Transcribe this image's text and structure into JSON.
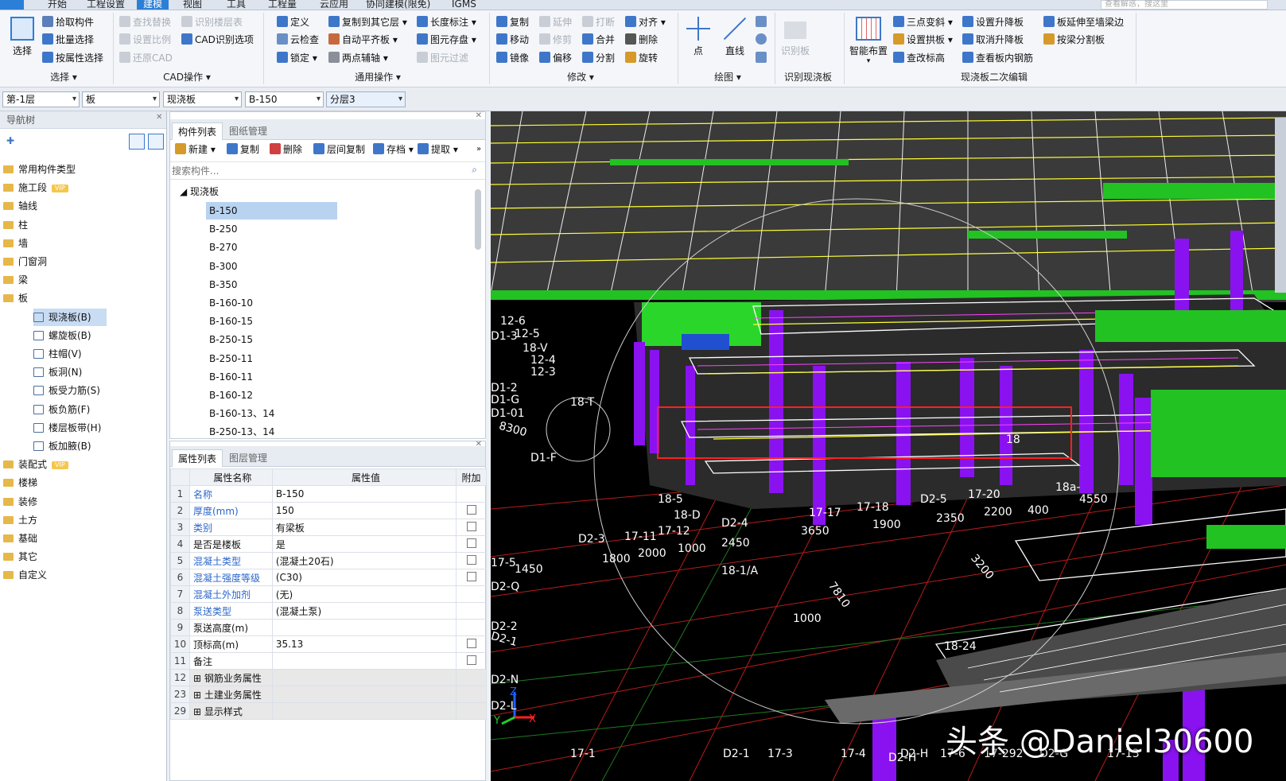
{
  "menubar": {
    "tabs": [
      "开始",
      "工程设置",
      "建模",
      "视图",
      "工具",
      "工程量",
      "云应用",
      "协同建模(限免)",
      "IGMS"
    ],
    "active_tab": "建模",
    "search_placeholder": "查看解惑，搜这里"
  },
  "ribbon": {
    "select_group": {
      "big": "选择",
      "items": [
        "拾取构件",
        "批量选择",
        "按属性选择"
      ],
      "label": "选择"
    },
    "cad_group": {
      "items": [
        "查找替换",
        "识别楼层表",
        "设置比例",
        "CAD识别选项",
        "还原CAD"
      ],
      "label": "CAD操作"
    },
    "general_group": {
      "items": [
        "定义",
        "复制到其它层",
        "长度标注",
        "云检查",
        "自动平齐板",
        "图元存盘",
        "锁定",
        "两点辅轴",
        "图元过滤"
      ],
      "label": "通用操作"
    },
    "modify_group": {
      "items": [
        "复制",
        "延伸",
        "打断",
        "对齐",
        "移动",
        "修剪",
        "合并",
        "删除",
        "镜像",
        "偏移",
        "分割",
        "旋转"
      ],
      "label": "修改"
    },
    "draw_group": {
      "items": [
        "点",
        "直线"
      ],
      "label": "绘图"
    },
    "identify_group": {
      "items": [
        "识别板"
      ],
      "label": "识别现浇板"
    },
    "edit_group": {
      "big": "智能布置",
      "items": [
        "三点变斜",
        "设置升降板",
        "板延伸至墙梁边",
        "设置拱板",
        "取消升降板",
        "按梁分割板",
        "查改标高",
        "查看板内钢筋"
      ],
      "label": "现浇板二次编辑"
    }
  },
  "combos": [
    "第-1层",
    "板",
    "现浇板",
    "B-150",
    "分层3"
  ],
  "nav": {
    "title": "导航树",
    "folders": [
      "常用构件类型",
      "施工段",
      "轴线",
      "柱",
      "墙",
      "门窗洞",
      "梁",
      "板",
      "装配式",
      "楼梯",
      "装修",
      "土方",
      "基础",
      "其它",
      "自定义"
    ],
    "vip_label": "VIP",
    "board_children": [
      "现浇板(B)",
      "螺旋板(B)",
      "柱帽(V)",
      "板洞(N)",
      "板受力筋(S)",
      "板负筋(F)",
      "楼层板带(H)",
      "板加腋(B)"
    ]
  },
  "component_list": {
    "tabs": [
      "构件列表",
      "图纸管理"
    ],
    "toolbar": [
      "新建",
      "复制",
      "删除",
      "层间复制",
      "存档",
      "提取"
    ],
    "search_placeholder": "搜索构件...",
    "root": "现浇板",
    "items": [
      "B-150",
      "B-250",
      "B-270",
      "B-300",
      "B-350",
      "B-160-10",
      "B-160-15",
      "B-250-15",
      "B-250-11",
      "B-160-11",
      "B-160-12",
      "B-160-13、14",
      "B-250-13、14"
    ],
    "selected": "B-150"
  },
  "properties": {
    "tabs": [
      "属性列表",
      "图层管理"
    ],
    "headers": [
      "属性名称",
      "属性值",
      "附加"
    ],
    "rows": [
      {
        "num": "1",
        "name": "名称",
        "value": "B-150",
        "blue": true,
        "check": false
      },
      {
        "num": "2",
        "name": "厚度(mm)",
        "value": "150",
        "blue": true,
        "check": true
      },
      {
        "num": "3",
        "name": "类别",
        "value": "有梁板",
        "blue": true,
        "check": true
      },
      {
        "num": "4",
        "name": "是否是楼板",
        "value": "是",
        "blue": false,
        "check": true
      },
      {
        "num": "5",
        "name": "混凝土类型",
        "value": "(混凝土20石)",
        "blue": true,
        "check": true
      },
      {
        "num": "6",
        "name": "混凝土强度等级",
        "value": "(C30)",
        "blue": true,
        "check": true
      },
      {
        "num": "7",
        "name": "混凝土外加剂",
        "value": "(无)",
        "blue": true,
        "check": false
      },
      {
        "num": "8",
        "name": "泵送类型",
        "value": "(混凝土泵)",
        "blue": true,
        "check": false
      },
      {
        "num": "9",
        "name": "泵送高度(m)",
        "value": "",
        "blue": false,
        "check": false
      },
      {
        "num": "10",
        "name": "顶标高(m)",
        "value": "35.13",
        "blue": false,
        "check": true
      },
      {
        "num": "11",
        "name": "备注",
        "value": "",
        "blue": false,
        "check": true
      },
      {
        "num": "12",
        "name": "钢筋业务属性",
        "value": "",
        "blue": false,
        "check": false,
        "group": true
      },
      {
        "num": "23",
        "name": "土建业务属性",
        "value": "",
        "blue": false,
        "check": false,
        "group": true
      },
      {
        "num": "29",
        "name": "显示样式",
        "value": "",
        "blue": false,
        "check": false,
        "group": true
      }
    ]
  },
  "viewport": {
    "labels": [
      "D1-3",
      "12-6",
      "12-5",
      "18-V",
      "12-4",
      "12-3",
      "D1-2",
      "D1-G",
      "D1-01",
      "18-T",
      "8300",
      "D1-F",
      "18-D",
      "18-5",
      "17-17",
      "17-18",
      "D2-5",
      "17-20",
      "2200",
      "400",
      "18a-",
      "4550",
      "1900",
      "2350",
      "3650",
      "D2-4",
      "17-11",
      "17-12",
      "2000",
      "1000",
      "2450",
      "18-1/A",
      "17-5",
      "D2-3",
      "1450",
      "1800",
      "D2-Q",
      "7810",
      "1000",
      "D2-2",
      "D2-1",
      "18-24",
      "D2-N",
      "D2-L",
      "D2-H",
      "17-1",
      "D2-1",
      "17-3",
      "17-4",
      "D2-H",
      "17-6",
      "17-292",
      "D2-G",
      "17-13",
      "18",
      "3200"
    ],
    "axis_labels": [
      "Z",
      "X",
      "Y"
    ]
  },
  "watermark": "头条 @Daniel30600"
}
